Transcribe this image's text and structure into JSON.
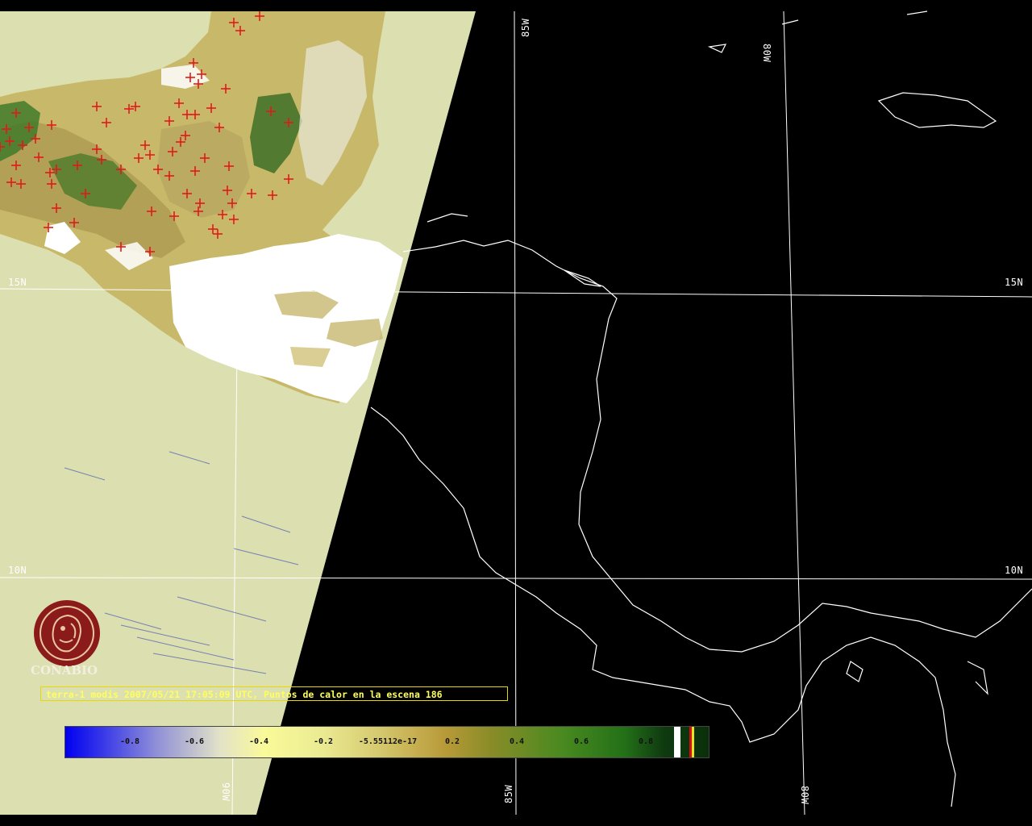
{
  "map": {
    "longitude_labels": [
      "85W",
      "80W",
      "90W",
      "85W",
      "80W"
    ],
    "latitude_labels": [
      "15N",
      "15N",
      "10N",
      "10N"
    ],
    "land_color": "#dcdfb0",
    "hotspot_color": "#e21a1a",
    "coast_color": "#ffffff"
  },
  "caption": {
    "text": "terra-1 modis 2007/05/21 17:05:09 UTC, Puntos de calor en la escena 186"
  },
  "colorbar": {
    "ticks": [
      "-0.8",
      "-0.6",
      "-0.4",
      "-0.2",
      "-5.55112e-17",
      "0.2",
      "0.4",
      "0.6",
      "0.8"
    ]
  },
  "logo": {
    "text": "CONABIO",
    "color": "#8b1a1a"
  }
}
